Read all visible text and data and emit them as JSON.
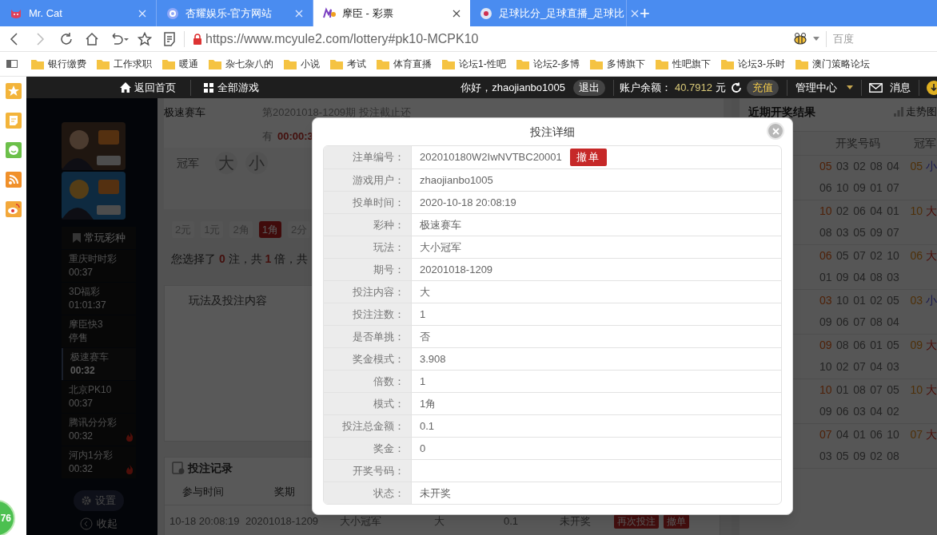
{
  "browser": {
    "tabs": [
      {
        "title": "Mr. Cat",
        "selected": false
      },
      {
        "title": "杏耀娱乐-官方网站",
        "selected": false
      },
      {
        "title": "摩臣 - 彩票",
        "selected": true
      },
      {
        "title": "足球比分_足球直播_足球比",
        "selected": false
      }
    ],
    "new_tab": "+",
    "url": "https://www.mcyule2.com/lottery#pk10-MCPK10",
    "search_placeholder": "百度",
    "bookmarks": [
      "银行缴费",
      "工作求职",
      "暖通",
      "杂七杂八的",
      "小说",
      "考试",
      "体育直播",
      "论坛1-性吧",
      "论坛2-多博",
      "多博旗下",
      "性吧旗下",
      "论坛3-乐时",
      "澳门策略论坛"
    ]
  },
  "side_strip": {
    "badge": "76"
  },
  "nav": {
    "home": "返回首页",
    "games": "全部游戏",
    "greeting": "你好，zhaojianbo1005",
    "logout": "退出",
    "balance_label": "账户余额：",
    "balance": "40.7912",
    "currency": "元",
    "recharge": "充值",
    "admin": "管理中心",
    "messages": "消息"
  },
  "sidebar": {
    "favorites_title": "常玩彩种",
    "games": [
      {
        "name": "重庆时时彩",
        "time": "00:37",
        "selected": false,
        "hot": false
      },
      {
        "name": "3D福彩",
        "time": "01:01:37",
        "selected": false,
        "hot": false
      },
      {
        "name": "摩臣快3",
        "time": "停售",
        "selected": false,
        "hot": false
      },
      {
        "name": "极速赛车",
        "time": "00:32",
        "selected": true,
        "hot": false
      },
      {
        "name": "北京PK10",
        "time": "00:37",
        "selected": false,
        "hot": false
      },
      {
        "name": "腾讯分分彩",
        "time": "00:32",
        "selected": false,
        "hot": true
      },
      {
        "name": "河内1分彩",
        "time": "00:32",
        "selected": false,
        "hot": true
      }
    ],
    "settings": "设置",
    "collapse": "收起"
  },
  "main": {
    "game_title": "极速赛车",
    "issue": "第20201018-1209期 投注截止还",
    "countdown_prefix": "有",
    "countdown": "00:00:3",
    "position": "冠军",
    "options": [
      "大",
      "小"
    ],
    "units": [
      {
        "label": "2元",
        "selected": false
      },
      {
        "label": "1元",
        "selected": false
      },
      {
        "label": "2角",
        "selected": false
      },
      {
        "label": "1角",
        "selected": true
      },
      {
        "label": "2分",
        "selected": false
      }
    ],
    "summary": "您选择了 **0** 注，共 **1** 倍，共",
    "content_title": "玩法及投注内容"
  },
  "records": {
    "title": "投注记录",
    "columns": [
      "参与时间",
      "奖期"
    ],
    "row": [
      "10-18 20:08:19",
      "20201018-1209",
      "大小冠军",
      "大",
      "0.1",
      "未开奖"
    ],
    "actions": [
      "再次投注",
      "撤单"
    ]
  },
  "results": {
    "title": "近期开奖结果",
    "trend": "走势图",
    "columns": [
      "开奖号码",
      "冠军"
    ],
    "rows": [
      {
        "numbers": [
          "05",
          "03",
          "02",
          "08",
          "04",
          "06",
          "10",
          "09",
          "01",
          "07"
        ],
        "champion": "05",
        "size": "小",
        "kind": "small"
      },
      {
        "numbers": [
          "10",
          "02",
          "06",
          "04",
          "01",
          "08",
          "03",
          "05",
          "09",
          "07"
        ],
        "champion": "10",
        "size": "大",
        "kind": "big"
      },
      {
        "numbers": [
          "06",
          "05",
          "07",
          "02",
          "10",
          "01",
          "09",
          "04",
          "08",
          "03"
        ],
        "champion": "06",
        "size": "大",
        "kind": "big"
      },
      {
        "numbers": [
          "03",
          "10",
          "01",
          "02",
          "05",
          "09",
          "06",
          "07",
          "08",
          "04"
        ],
        "champion": "03",
        "size": "小",
        "kind": "small"
      },
      {
        "numbers": [
          "09",
          "08",
          "06",
          "01",
          "05",
          "10",
          "02",
          "07",
          "04",
          "03"
        ],
        "champion": "09",
        "size": "大",
        "kind": "big"
      },
      {
        "numbers": [
          "10",
          "01",
          "08",
          "07",
          "05",
          "09",
          "06",
          "03",
          "04",
          "02"
        ],
        "champion": "10",
        "size": "大",
        "kind": "big"
      },
      {
        "numbers": [
          "07",
          "04",
          "01",
          "06",
          "10",
          "03",
          "05",
          "09",
          "02",
          "08"
        ],
        "champion": "07",
        "size": "大",
        "kind": "big"
      }
    ]
  },
  "modal": {
    "title": "投注详细",
    "fields": [
      {
        "label": "注单编号：",
        "value": "202010180W2IwNVTBC20001",
        "action": "撤单"
      },
      {
        "label": "游戏用户：",
        "value": "zhaojianbo1005"
      },
      {
        "label": "投单时间：",
        "value": "2020-10-18 20:08:19"
      },
      {
        "label": "彩种：",
        "value": "极速赛车"
      },
      {
        "label": "玩法：",
        "value": "大小冠军"
      },
      {
        "label": "期号：",
        "value": "20201018-1209"
      },
      {
        "label": "投注内容：",
        "value": "大"
      },
      {
        "label": "投注注数：",
        "value": "1"
      },
      {
        "label": "是否单挑：",
        "value": "否"
      },
      {
        "label": "奖金模式：",
        "value": "3.908"
      },
      {
        "label": "倍数：",
        "value": "1"
      },
      {
        "label": "模式：",
        "value": "1角"
      },
      {
        "label": "投注总金额：",
        "value": "0.1"
      },
      {
        "label": "奖金：",
        "value": "0"
      },
      {
        "label": "开奖号码："
      },
      {
        "label": "状态：",
        "value": "未开奖"
      }
    ]
  }
}
